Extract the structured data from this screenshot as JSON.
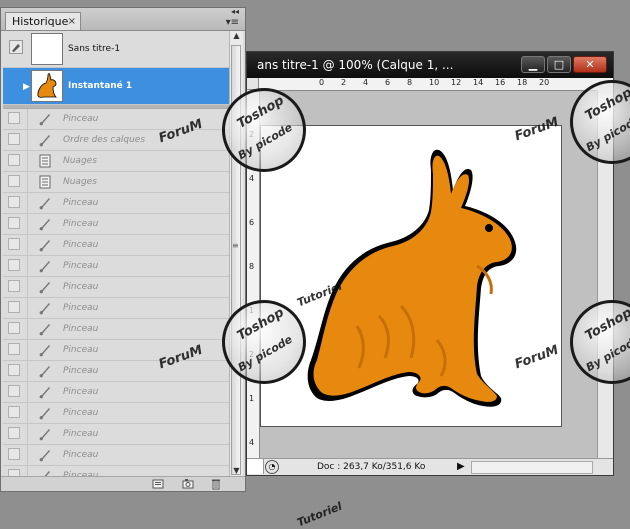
{
  "document_window": {
    "title": "ans titre-1 @ 100% (Calque 1, ...",
    "ruler_h_ticks": [
      "0",
      "2",
      "4",
      "6",
      "8",
      "10",
      "12",
      "14",
      "16",
      "18",
      "20"
    ],
    "ruler_v_ticks": [
      "2",
      "4",
      "6",
      "8",
      "1",
      "2",
      "1",
      "4"
    ],
    "status_text": "Doc : 263,7 Ko/351,6 Ko",
    "canvas_color": "#ffffff",
    "rabbit_color": "#e8890f"
  },
  "history_panel": {
    "tab_label": "Historique",
    "tab_close": "×",
    "snapshots": [
      {
        "label": "Sans titre-1",
        "icon": "blank-thumbnail"
      },
      {
        "label": "Instantané 1",
        "icon": "rabbit-thumbnail",
        "selected": true
      }
    ],
    "steps": [
      {
        "label": "Pinceau",
        "icon": "brush-icon"
      },
      {
        "label": "Ordre des calques",
        "icon": "brush-icon"
      },
      {
        "label": "Nuages",
        "icon": "document-icon"
      },
      {
        "label": "Nuages",
        "icon": "document-icon"
      },
      {
        "label": "Pinceau",
        "icon": "brush-icon"
      },
      {
        "label": "Pinceau",
        "icon": "brush-icon"
      },
      {
        "label": "Pinceau",
        "icon": "brush-icon"
      },
      {
        "label": "Pinceau",
        "icon": "brush-icon"
      },
      {
        "label": "Pinceau",
        "icon": "brush-icon"
      },
      {
        "label": "Pinceau",
        "icon": "brush-icon"
      },
      {
        "label": "Pinceau",
        "icon": "brush-icon"
      },
      {
        "label": "Pinceau",
        "icon": "brush-icon"
      },
      {
        "label": "Pinceau",
        "icon": "brush-icon"
      },
      {
        "label": "Pinceau",
        "icon": "brush-icon"
      },
      {
        "label": "Pinceau",
        "icon": "brush-icon"
      },
      {
        "label": "Pinceau",
        "icon": "brush-icon"
      },
      {
        "label": "Pinceau",
        "icon": "brush-icon"
      },
      {
        "label": "Pinceau",
        "icon": "brush-icon"
      }
    ],
    "accent_color": "#3d8fe0"
  },
  "watermarks": {
    "forum": "ForuM",
    "toshop": "Toshop",
    "by_picode": "By picode",
    "tutoriel": "Tutoriel"
  }
}
